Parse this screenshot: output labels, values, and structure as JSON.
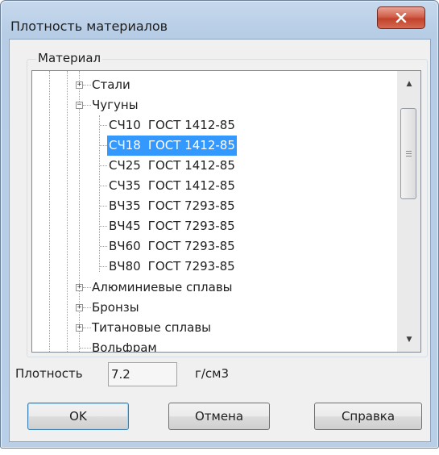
{
  "window": {
    "title": "Плотность материалов",
    "close_icon": "close-icon"
  },
  "material_group": {
    "label": "Материал"
  },
  "tree": {
    "groups": [
      {
        "label": "Стали",
        "expander": "⊞"
      },
      {
        "label": "Чугуны",
        "expander": "⊟"
      },
      {
        "label": "Алюминиевые сплавы",
        "expander": "⊞"
      },
      {
        "label": "Бронзы",
        "expander": "⊞"
      },
      {
        "label": "Титановые сплавы",
        "expander": "⊞"
      },
      {
        "label": "Вольфрам"
      }
    ],
    "cast_iron_items": [
      {
        "grade": "СЧ10",
        "standard": "ГОСТ 1412-85"
      },
      {
        "grade": "СЧ18",
        "standard": "ГОСТ 1412-85",
        "selected": true
      },
      {
        "grade": "СЧ25",
        "standard": "ГОСТ 1412-85"
      },
      {
        "grade": "СЧ35",
        "standard": "ГОСТ 1412-85"
      },
      {
        "grade": "ВЧ35",
        "standard": "ГОСТ 7293-85"
      },
      {
        "grade": "ВЧ45",
        "standard": "ГОСТ 7293-85"
      },
      {
        "grade": "ВЧ60",
        "standard": "ГОСТ 7293-85"
      },
      {
        "grade": "ВЧ80",
        "standard": "ГОСТ 7293-85"
      }
    ],
    "selection_color": "#3399ff"
  },
  "density": {
    "label": "Плотность",
    "value": "7.2",
    "unit": "г/см3"
  },
  "buttons": {
    "ok": "OK",
    "cancel": "Отмена",
    "help": "Справка"
  }
}
